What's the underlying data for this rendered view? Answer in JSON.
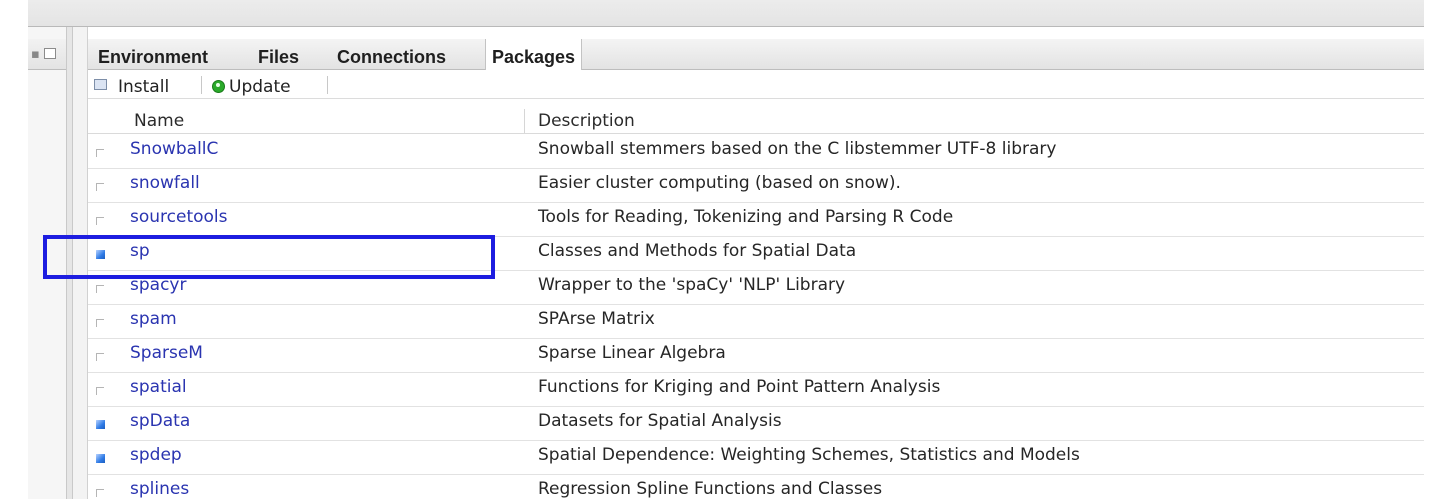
{
  "tabs": [
    {
      "label": "Environment",
      "active": false
    },
    {
      "label": "Files",
      "active": false
    },
    {
      "label": "Connections",
      "active": false
    },
    {
      "label": "Packages",
      "active": true
    }
  ],
  "toolbar": {
    "install_label": "Install",
    "update_label": "Update",
    "install_icon": "install-icon",
    "update_icon": "update-icon"
  },
  "table": {
    "columns": {
      "name": "Name",
      "description": "Description"
    },
    "rows": [
      {
        "name": "SnowballC",
        "description": "Snowball stemmers based on the C libstemmer UTF-8 library",
        "loaded": false
      },
      {
        "name": "snowfall",
        "description": "Easier cluster computing (based on snow).",
        "loaded": false
      },
      {
        "name": "sourcetools",
        "description": "Tools for Reading, Tokenizing and Parsing R Code",
        "loaded": false
      },
      {
        "name": "sp",
        "description": "Classes and Methods for Spatial Data",
        "loaded": true
      },
      {
        "name": "spacyr",
        "description": "Wrapper to the 'spaCy' 'NLP' Library",
        "loaded": false
      },
      {
        "name": "spam",
        "description": "SPArse Matrix",
        "loaded": false
      },
      {
        "name": "SparseM",
        "description": "Sparse Linear Algebra",
        "loaded": false
      },
      {
        "name": "spatial",
        "description": "Functions for Kriging and Point Pattern Analysis",
        "loaded": false
      },
      {
        "name": "spData",
        "description": "Datasets for Spatial Analysis",
        "loaded": true
      },
      {
        "name": "spdep",
        "description": "Spatial Dependence: Weighting Schemes, Statistics and Models",
        "loaded": true
      },
      {
        "name": "splines",
        "description": "Regression Spline Functions and Classes",
        "loaded": false
      }
    ]
  },
  "colors": {
    "link": "#2a34b0",
    "highlight": "#1d1de0",
    "checked": "#2f7be6"
  }
}
